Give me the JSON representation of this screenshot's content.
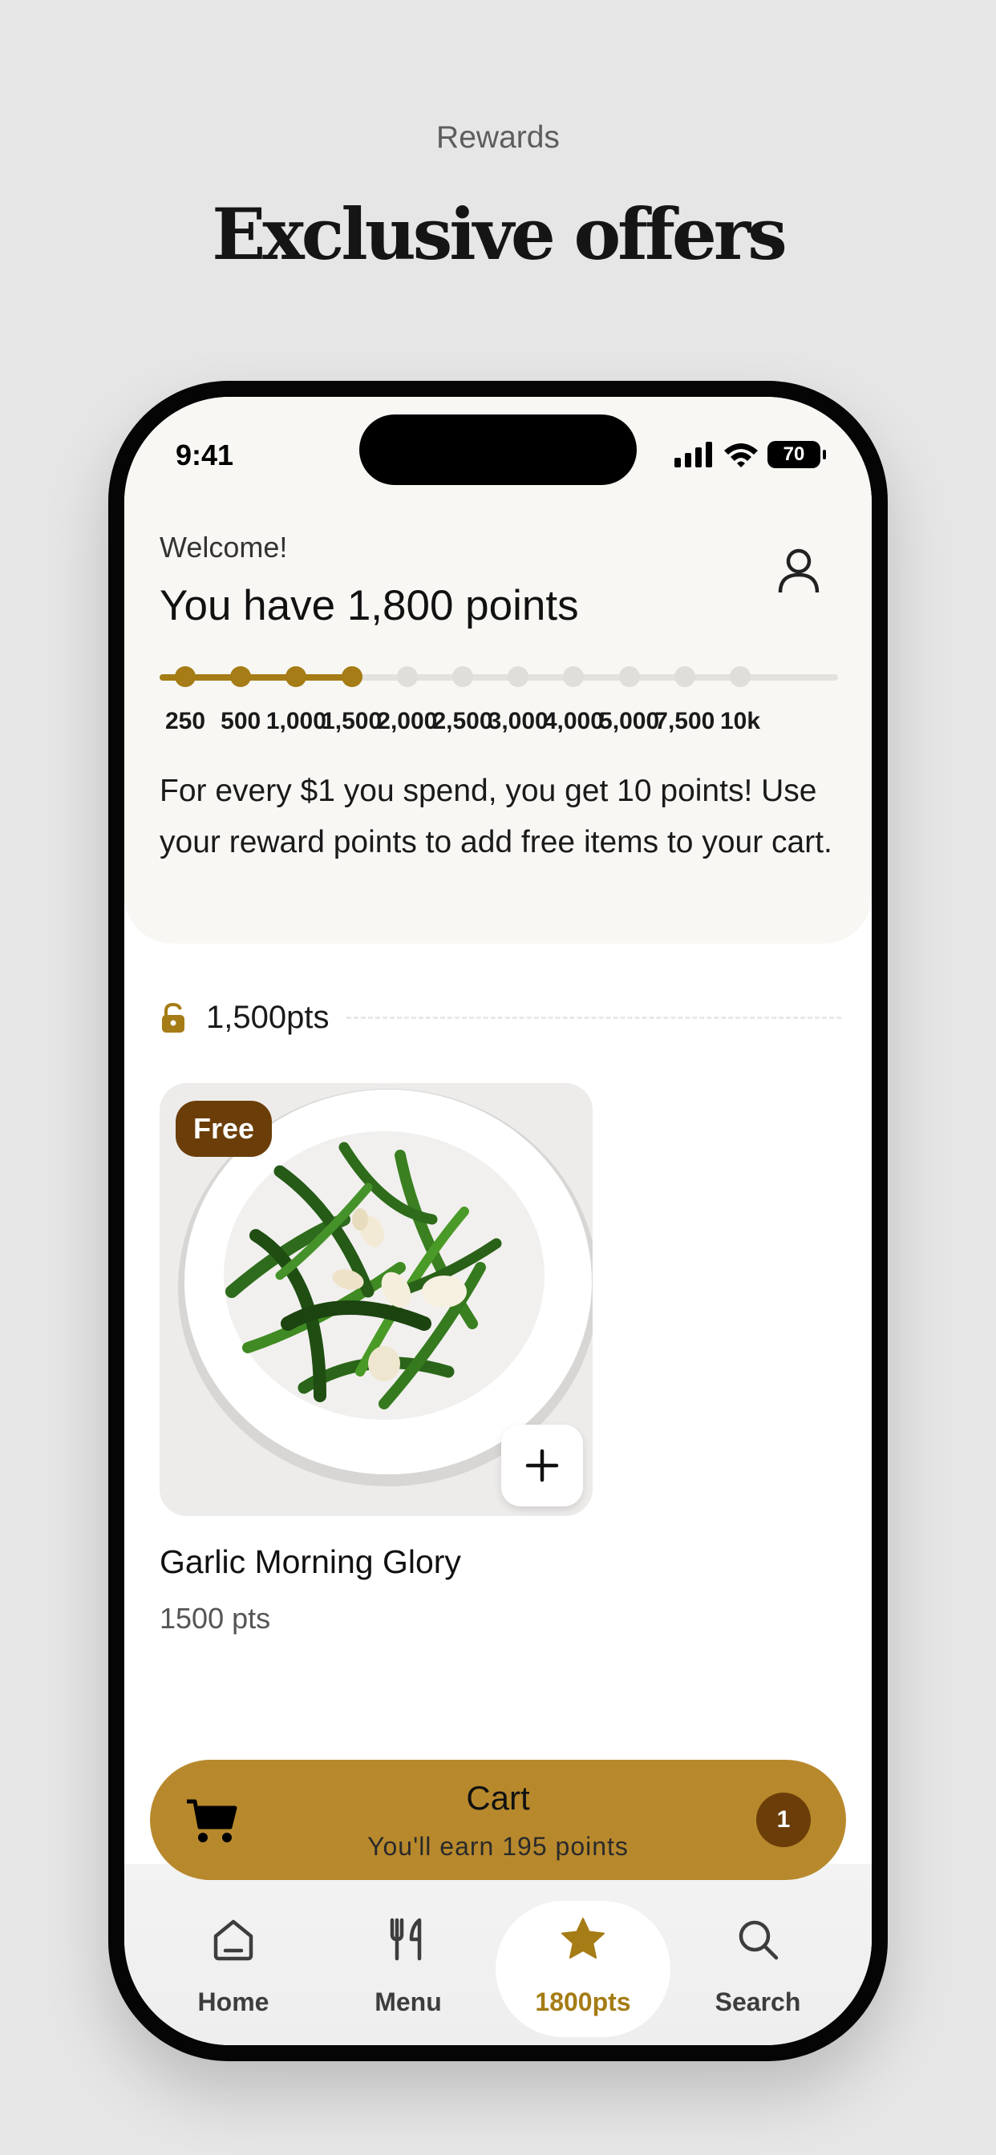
{
  "header": {
    "eyebrow": "Rewards",
    "title": "Exclusive offers"
  },
  "status_bar": {
    "time": "9:41",
    "battery": "70"
  },
  "welcome": {
    "greeting": "Welcome!",
    "points_line": "You have 1,800 points"
  },
  "progress": {
    "current_points": 1800,
    "milestones": [
      "250",
      "500",
      "1,000",
      "1,500",
      "2,000",
      "2,500",
      "3,000",
      "4,000",
      "5,000",
      "7,500",
      "10k"
    ],
    "reached_count": 4
  },
  "info_text": "For every $1 you spend, you get 10 points! Use your reward points to add free items to your cart.",
  "section": {
    "label": "1,500pts",
    "icon": "unlock-icon"
  },
  "item": {
    "badge": "Free",
    "name": "Garlic Morning Glory",
    "price": "1500 pts"
  },
  "cart": {
    "title": "Cart",
    "subtitle": "You'll earn 195 points",
    "count": "1"
  },
  "nav": {
    "items": [
      {
        "label": "Home",
        "icon": "home-icon"
      },
      {
        "label": "Menu",
        "icon": "utensils-icon"
      },
      {
        "label": "1800pts",
        "icon": "star-icon",
        "active": true
      },
      {
        "label": "Search",
        "icon": "search-icon"
      }
    ]
  },
  "colors": {
    "accent": "#a57c15",
    "cart_bar": "#b8892c",
    "badge": "#6b3e09",
    "background": "#e6e6e6"
  }
}
